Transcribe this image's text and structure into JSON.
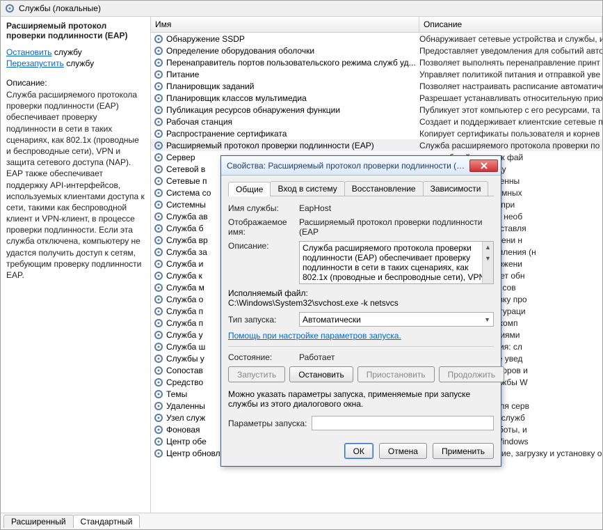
{
  "titlebar": {
    "title": "Службы (локальные)"
  },
  "left": {
    "service_title": "Расширяемый протокол проверки подлинности (EAP)",
    "stop_action": "Остановить",
    "restart_action": "Перезапустить",
    "suffix": " службу",
    "desc_label": "Описание:",
    "desc_text": "Служба расширяемого протокола проверки подлинности (EAP) обеспечивает проверку подлинности в сети в таких сценариях, как 802.1x (проводные и беспроводные сети), VPN и защита сетевого доступа (NAP).  EAP также обеспечивает поддержку API-интерфейсов, используемых клиентами доступа к сети, такими как беспроводной клиент и VPN-клиент, в процессе проверки подлинности.  Если эта служба отключена, компьютеру не удастся получить доступ к сетям, требующим проверку подлинности EAP."
  },
  "columns": {
    "name": "Имя",
    "desc": "Описание"
  },
  "rows": [
    {
      "n": "Обнаружение SSDP",
      "d": "Обнаруживает сетевые устройства и службы, и"
    },
    {
      "n": "Определение оборудования оболочки",
      "d": "Предоставляет уведомления для событий авто"
    },
    {
      "n": "Перенаправитель портов пользовательского режима служб уд...",
      "d": "Позволяет выполнять перенаправление принт"
    },
    {
      "n": "Питание",
      "d": "Управляет политикой питания и отправкой уве"
    },
    {
      "n": "Планировщик заданий",
      "d": "Позволяет настраивать расписание автоматиче"
    },
    {
      "n": "Планировщик классов мультимедиа",
      "d": "Разрешает устанавливать относительную прио"
    },
    {
      "n": "Публикация ресурсов обнаружения функции",
      "d": "Публикует этот компьютер с его ресурсами, та"
    },
    {
      "n": "Рабочая станция",
      "d": "Создает и поддерживает клиентские сетевые по"
    },
    {
      "n": "Распространение сертификата",
      "d": "Копирует сертификаты пользователя и корнев"
    },
    {
      "n": "Расширяемый протокол проверки подлинности (EAP)",
      "d": "Служба расширяемого протокола проверки по",
      "sel": true
    },
    {
      "n": "Сервер",
      "d": "ержку общий доступ к фай"
    },
    {
      "n": "Сетевой в",
      "d": "ый канал связи между"
    },
    {
      "n": "Сетевые п",
      "d": "и папки \"Сеть и удаленны"
    },
    {
      "n": "Система со",
      "d": "уведомления о системных"
    },
    {
      "n": "Системны",
      "d": "ий и отслеживанием при"
    },
    {
      "n": "Служба ав",
      "d": "редоставляет логику, необ"
    },
    {
      "n": "Служба б",
      "d": "льтрации (BFE) представля"
    },
    {
      "n": "Служба вр",
      "d": "изацией даты и времени н"
    },
    {
      "n": "Служба за",
      "d": "ыает сетевые уведомления (н"
    },
    {
      "n": "Служба и",
      "d": "ильзованности приложени"
    },
    {
      "n": "Служба к",
      "d": "диагностики позволяет обн"
    },
    {
      "n": "Служба м",
      "d": "ержку помощника по сов"
    },
    {
      "n": "Служба о",
      "d": "г за загрузку и выгрузку про"
    },
    {
      "n": "Служба п",
      "d": "эт сведения о конфигураци"
    },
    {
      "n": "Служба п",
      "d": " которым подключен комп"
    },
    {
      "n": "Служба у",
      "d": "а системными событиями"
    },
    {
      "n": "Служба ш",
      "d": "ре службы управления: сл"
    },
    {
      "n": "Службы у",
      "d": "телям интерактивное увед"
    },
    {
      "n": "Сопостав",
      "d": "ешение идентификаторов и"
    },
    {
      "n": "Средство",
      "d": "стройствами для службы W"
    },
    {
      "n": "Темы",
      "d": "и оформления."
    },
    {
      "n": "Удаленны",
      "d": "а диспетчер служб для серв"
    },
    {
      "n": "Узел служ",
      "d": "остики используется служб"
    },
    {
      "n": "Фоновая",
      "d": "фоновом режиме работы, и"
    },
    {
      "n": "Центр обе",
      "d": "ентр безопасности Windows"
    },
    {
      "n": "Центр обновления Windows",
      "d": "Включает обнаружение, загрузку и установку о"
    }
  ],
  "bottom_tabs": {
    "extended": "Расширенный",
    "standard": "Стандартный"
  },
  "dlg": {
    "title": "Свойства: Расширяемый протокол проверки подлинности (EAP...",
    "tabs": {
      "general": "Общие",
      "logon": "Вход в систему",
      "recovery": "Восстановление",
      "deps": "Зависимости"
    },
    "lbl_service_name": "Имя службы:",
    "val_service_name": "EapHost",
    "lbl_display_name": "Отображаемое имя:",
    "val_display_name": "Расширяемый протокол проверки подлинности (EAP",
    "lbl_desc": "Описание:",
    "val_desc": "Служба расширяемого протокола проверки подлинности (EAP) обеспечивает проверку подлинности в сети в таких сценариях, как 802.1x (проводные и беспроводные сети), VPN и",
    "lbl_exe": "Исполняемый файл:",
    "val_exe": "C:\\Windows\\System32\\svchost.exe -k netsvcs",
    "lbl_startup": "Тип запуска:",
    "val_startup": "Автоматически",
    "help_link": "Помощь при настройке параметров запуска.",
    "lbl_state": "Состояние:",
    "val_state": "Работает",
    "btn_start": "Запустить",
    "btn_stop": "Остановить",
    "btn_pause": "Приостановить",
    "btn_resume": "Продолжить",
    "hint": "Можно указать параметры запуска, применяемые при запуске службы из этого диалогового окна.",
    "lbl_params": "Параметры запуска:",
    "btn_ok": "ОК",
    "btn_cancel": "Отмена",
    "btn_apply": "Применить"
  }
}
